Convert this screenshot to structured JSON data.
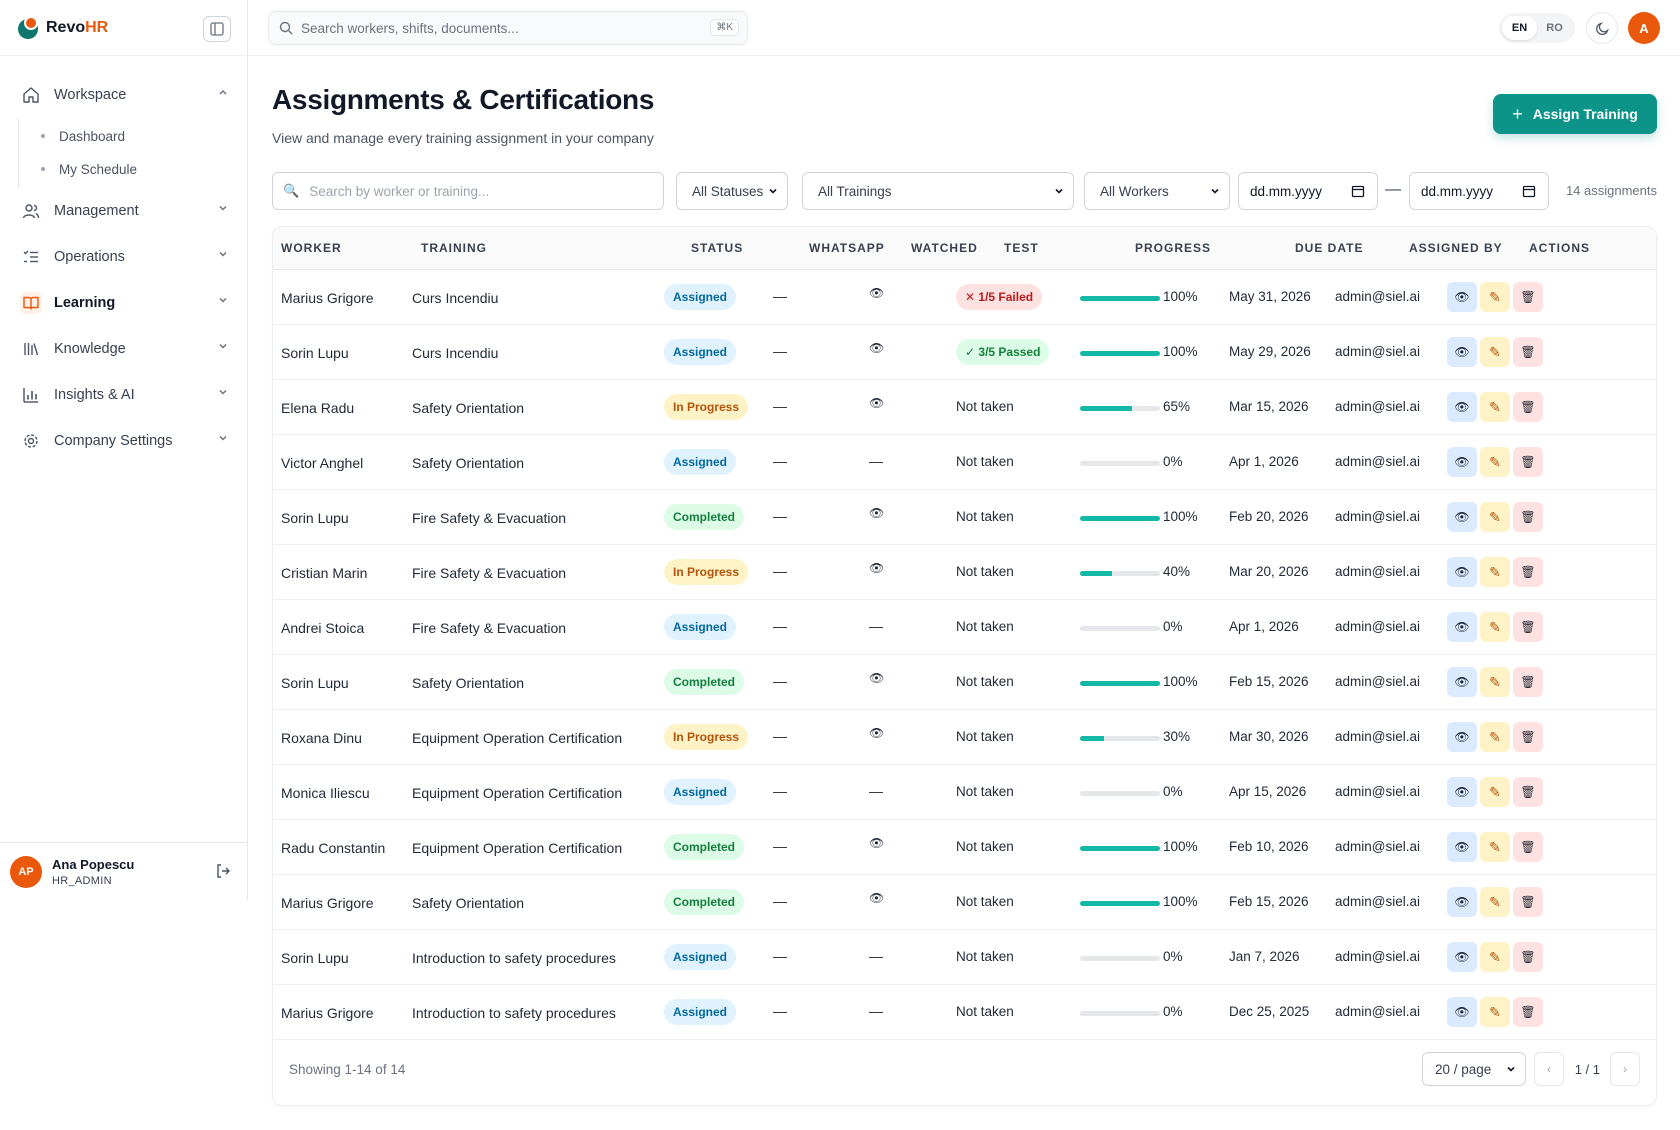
{
  "brand": {
    "name_main": "Revo",
    "name_accent": "HR"
  },
  "sidebar": {
    "items": [
      {
        "label": "Workspace",
        "icon": "home-icon",
        "expanded": true,
        "sub": [
          "Dashboard",
          "My Schedule"
        ]
      },
      {
        "label": "Management",
        "icon": "users-icon"
      },
      {
        "label": "Operations",
        "icon": "list-check-icon"
      },
      {
        "label": "Learning",
        "icon": "book-open-icon",
        "active": true
      },
      {
        "label": "Knowledge",
        "icon": "library-icon"
      },
      {
        "label": "Insights & AI",
        "icon": "bar-chart-icon"
      },
      {
        "label": "Company Settings",
        "icon": "gear-icon"
      }
    ],
    "user": {
      "initials": "AP",
      "name": "Ana Popescu",
      "role": "HR_ADMIN"
    }
  },
  "topbar": {
    "search_placeholder": "Search workers, shifts, documents...",
    "shortcut": "⌘K",
    "lang": [
      "EN",
      "RO"
    ],
    "avatar": "A"
  },
  "page": {
    "title": "Assignments & Certifications",
    "subtitle": "View and manage every training assignment in your company",
    "assign_button": "Assign Training"
  },
  "filters": {
    "search_placeholder": "Search by worker or training...",
    "status": "All Statuses",
    "training": "All Trainings",
    "worker": "All Workers",
    "date_from": "dd.mm.yyyy",
    "date_to": "dd.mm.yyyy",
    "separator": "—",
    "count": "14 assignments"
  },
  "table": {
    "headers": [
      "WORKER",
      "TRAINING",
      "STATUS",
      "WHATSAPP",
      "WATCHED",
      "TEST",
      "PROGRESS",
      "DUE DATE",
      "ASSIGNED BY",
      "ACTIONS"
    ],
    "rows": [
      {
        "worker": "Marius Grigore",
        "training": "Curs Incendiu",
        "status": "Assigned",
        "whatsapp": "—",
        "watched": "👁",
        "test": "✕ 1/5 Failed",
        "test_type": "failed",
        "progress": 100,
        "progress_label": "100%",
        "due": "May 31, 2026",
        "by": "admin@siel.ai"
      },
      {
        "worker": "Sorin Lupu",
        "training": "Curs Incendiu",
        "status": "Assigned",
        "whatsapp": "—",
        "watched": "👁",
        "test": "✓ 3/5 Passed",
        "test_type": "passed",
        "progress": 100,
        "progress_label": "100%",
        "due": "May 29, 2026",
        "by": "admin@siel.ai"
      },
      {
        "worker": "Elena Radu",
        "training": "Safety Orientation",
        "status": "In Progress",
        "whatsapp": "—",
        "watched": "👁",
        "test": "Not taken",
        "test_type": "none",
        "progress": 65,
        "progress_label": "65%",
        "due": "Mar 15, 2026",
        "by": "admin@siel.ai"
      },
      {
        "worker": "Victor Anghel",
        "training": "Safety Orientation",
        "status": "Assigned",
        "whatsapp": "—",
        "watched": "—",
        "test": "Not taken",
        "test_type": "none",
        "progress": 0,
        "progress_label": "0%",
        "due": "Apr 1, 2026",
        "by": "admin@siel.ai"
      },
      {
        "worker": "Sorin Lupu",
        "training": "Fire Safety & Evacuation",
        "status": "Completed",
        "whatsapp": "—",
        "watched": "👁",
        "test": "Not taken",
        "test_type": "none",
        "progress": 100,
        "progress_label": "100%",
        "due": "Feb 20, 2026",
        "by": "admin@siel.ai"
      },
      {
        "worker": "Cristian Marin",
        "training": "Fire Safety & Evacuation",
        "status": "In Progress",
        "whatsapp": "—",
        "watched": "👁",
        "test": "Not taken",
        "test_type": "none",
        "progress": 40,
        "progress_label": "40%",
        "due": "Mar 20, 2026",
        "by": "admin@siel.ai"
      },
      {
        "worker": "Andrei Stoica",
        "training": "Fire Safety & Evacuation",
        "status": "Assigned",
        "whatsapp": "—",
        "watched": "—",
        "test": "Not taken",
        "test_type": "none",
        "progress": 0,
        "progress_label": "0%",
        "due": "Apr 1, 2026",
        "by": "admin@siel.ai"
      },
      {
        "worker": "Sorin Lupu",
        "training": "Safety Orientation",
        "status": "Completed",
        "whatsapp": "—",
        "watched": "👁",
        "test": "Not taken",
        "test_type": "none",
        "progress": 100,
        "progress_label": "100%",
        "due": "Feb 15, 2026",
        "by": "admin@siel.ai"
      },
      {
        "worker": "Roxana Dinu",
        "training": "Equipment Operation Certification",
        "status": "In Progress",
        "whatsapp": "—",
        "watched": "👁",
        "test": "Not taken",
        "test_type": "none",
        "progress": 30,
        "progress_label": "30%",
        "due": "Mar 30, 2026",
        "by": "admin@siel.ai"
      },
      {
        "worker": "Monica Iliescu",
        "training": "Equipment Operation Certification",
        "status": "Assigned",
        "whatsapp": "—",
        "watched": "—",
        "test": "Not taken",
        "test_type": "none",
        "progress": 0,
        "progress_label": "0%",
        "due": "Apr 15, 2026",
        "by": "admin@siel.ai"
      },
      {
        "worker": "Radu Constantin",
        "training": "Equipment Operation Certification",
        "status": "Completed",
        "whatsapp": "—",
        "watched": "👁",
        "test": "Not taken",
        "test_type": "none",
        "progress": 100,
        "progress_label": "100%",
        "due": "Feb 10, 2026",
        "by": "admin@siel.ai"
      },
      {
        "worker": "Marius Grigore",
        "training": "Safety Orientation",
        "status": "Completed",
        "whatsapp": "—",
        "watched": "👁",
        "test": "Not taken",
        "test_type": "none",
        "progress": 100,
        "progress_label": "100%",
        "due": "Feb 15, 2026",
        "by": "admin@siel.ai"
      },
      {
        "worker": "Sorin Lupu",
        "training": "Introduction to safety procedures",
        "status": "Assigned",
        "whatsapp": "—",
        "watched": "—",
        "test": "Not taken",
        "test_type": "none",
        "progress": 0,
        "progress_label": "0%",
        "due": "Jan 7, 2026",
        "by": "admin@siel.ai"
      },
      {
        "worker": "Marius Grigore",
        "training": "Introduction to safety procedures",
        "status": "Assigned",
        "whatsapp": "—",
        "watched": "—",
        "test": "Not taken",
        "test_type": "none",
        "progress": 0,
        "progress_label": "0%",
        "due": "Dec 25, 2025",
        "by": "admin@siel.ai"
      }
    ],
    "actions": {
      "view": "👁",
      "edit": "✎",
      "delete": "🗑"
    }
  },
  "footer": {
    "showing": "Showing 1-14 of 14",
    "per_page": "20 / page",
    "prev": "‹",
    "next": "›",
    "page_info": "1 / 1"
  },
  "colors": {
    "accent": "#0d9488",
    "brand_orange": "#ea580c",
    "progress_fill": "#14b8a6"
  }
}
